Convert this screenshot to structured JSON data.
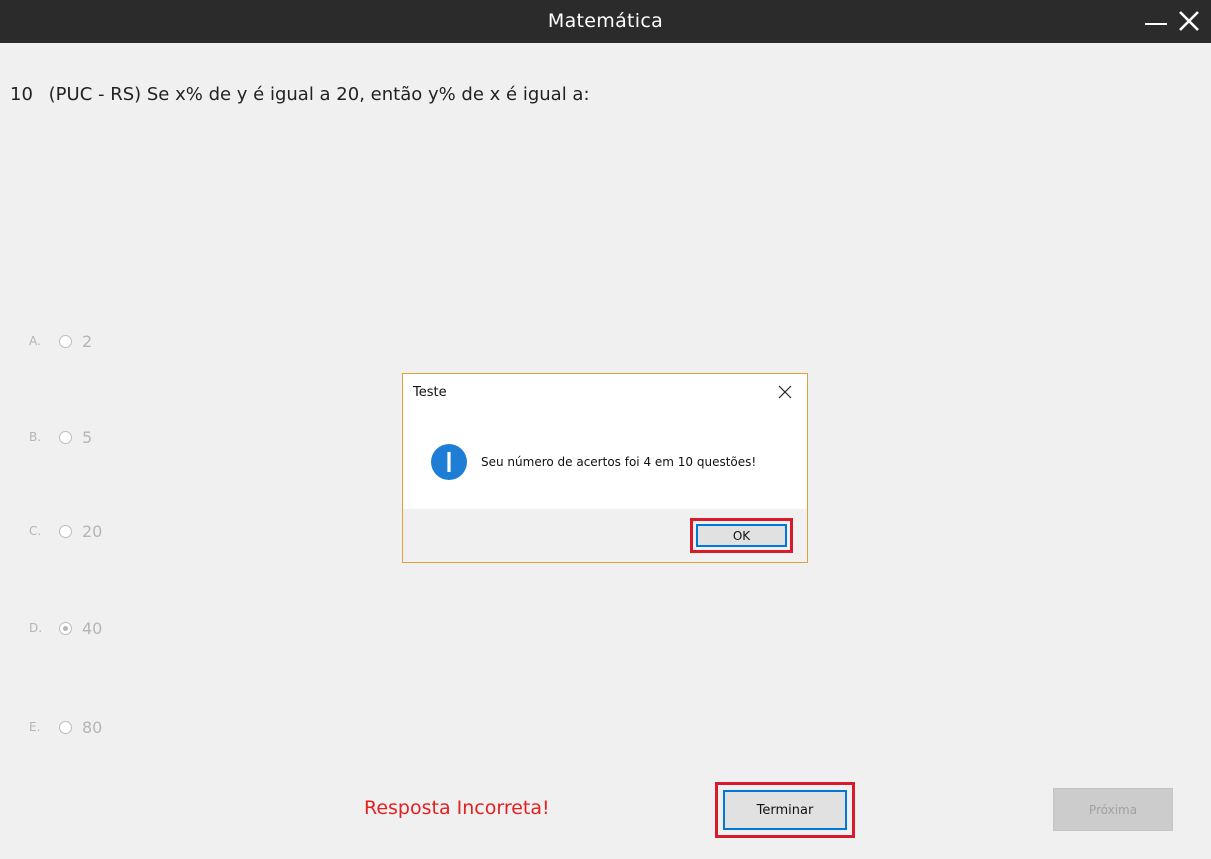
{
  "window": {
    "title": "Matemática",
    "minimize_icon": "minimize-icon",
    "close_icon": "close-icon"
  },
  "question": {
    "number": "10",
    "text": "(PUC - RS) Se x% de y é igual a 20, então y% de x é igual a:"
  },
  "options": [
    {
      "letter": "A.",
      "value": "2",
      "selected": false
    },
    {
      "letter": "B.",
      "value": "5",
      "selected": false
    },
    {
      "letter": "C.",
      "value": "20",
      "selected": false
    },
    {
      "letter": "D.",
      "value": "40",
      "selected": true
    },
    {
      "letter": "E.",
      "value": "80",
      "selected": false
    }
  ],
  "result_text": "Resposta Incorreta!",
  "buttons": {
    "terminar": "Terminar",
    "proxima": "Próxima"
  },
  "dialog": {
    "title": "Teste",
    "message": "Seu número de acertos foi 4 em 10 questões!",
    "ok_label": "OK",
    "icon": "info-icon",
    "close_icon": "close-icon"
  },
  "colors": {
    "titlebar": "#2b2b2b",
    "error_text": "#e32121",
    "highlight_box": "#d81b2a",
    "focus_border": "#0078d7",
    "info_icon": "#1e7ed6"
  }
}
